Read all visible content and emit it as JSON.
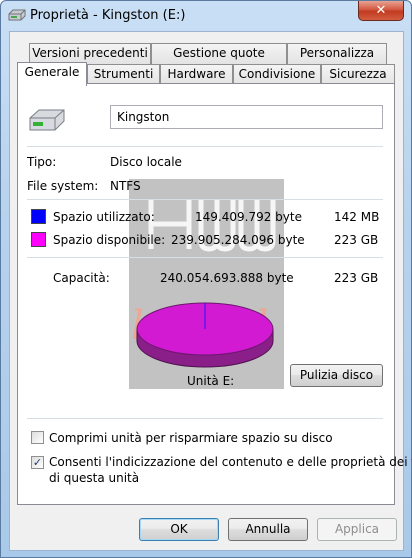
{
  "window": {
    "title": "Proprietà - Kingston (E:)",
    "close_glyph": "✕"
  },
  "tabs": {
    "row1": [
      "Versioni precedenti",
      "Gestione quote",
      "Personalizza"
    ],
    "row2": [
      "Generale",
      "Strumenti",
      "Hardware",
      "Condivisione",
      "Sicurezza"
    ],
    "active": "Generale"
  },
  "general": {
    "drive_name": "Kingston",
    "type_label": "Tipo:",
    "type_value": "Disco locale",
    "fs_label": "File system:",
    "fs_value": "NTFS",
    "used": {
      "label": "Spazio utilizzato:",
      "bytes": "149.409.792 byte",
      "size": "142 MB",
      "color": "#0000ff"
    },
    "free": {
      "label": "Spazio disponibile:",
      "bytes": "239.905.284.096 byte",
      "size": "223 GB",
      "color": "#ff00ff"
    },
    "capacity": {
      "label": "Capacità:",
      "bytes": "240.054.693.888 byte",
      "size": "223 GB"
    },
    "drive_label": "Unità E:",
    "cleanup_button": "Pulizia disco",
    "used_fraction": 0.0006,
    "compress_checkbox": {
      "label": "Comprimi unità per risparmiare spazio su disco",
      "checked": false
    },
    "index_checkbox": {
      "label_line1": "Consenti l'indicizzazione del contenuto e delle proprietà dei file",
      "label_line2": "di questa unità",
      "checked": true,
      "check_glyph": "✓"
    }
  },
  "watermark": {
    "text": "legend"
  },
  "buttons": {
    "ok": "OK",
    "cancel": "Annulla",
    "apply": "Applica"
  }
}
